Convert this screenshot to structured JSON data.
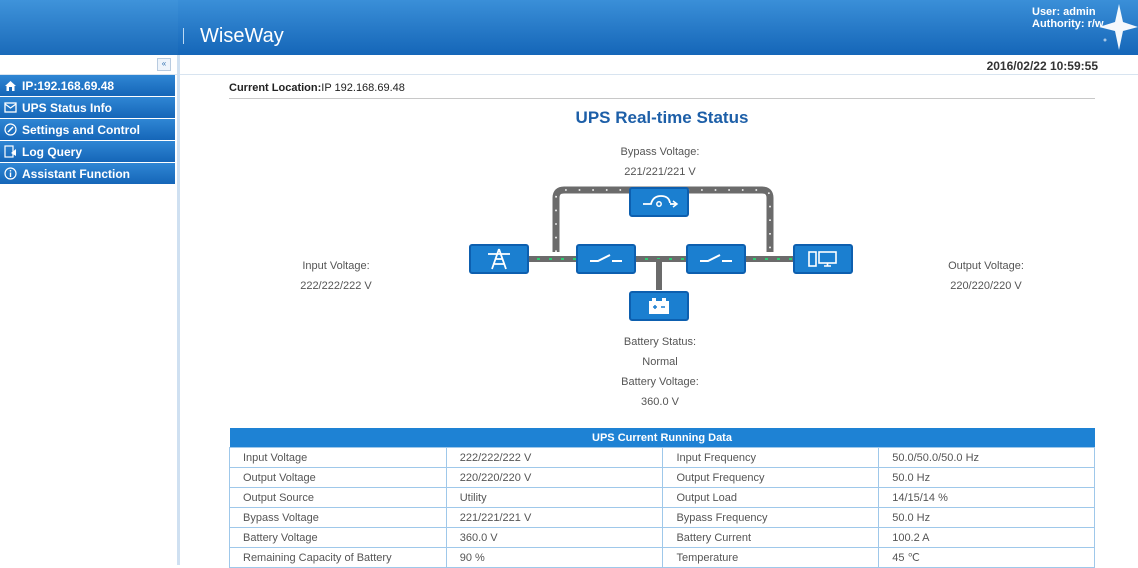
{
  "header": {
    "title": "WiseWay",
    "user": "User: admin",
    "authority": "Authority: r/w"
  },
  "datetime": "2016/02/22 10:59:55",
  "collapse_label": "«",
  "menu": [
    {
      "label": "IP:192.168.69.48",
      "icon": "home-icon"
    },
    {
      "label": "UPS Status Info",
      "icon": "status-info-icon"
    },
    {
      "label": "Settings and Control",
      "icon": "settings-icon"
    },
    {
      "label": "Log Query",
      "icon": "log-icon"
    },
    {
      "label": "Assistant Function",
      "icon": "info-icon"
    }
  ],
  "location": {
    "prefix": "Current Location:",
    "value": "IP 192.168.69.48"
  },
  "realtime": {
    "title": "UPS Real-time Status",
    "bypass_label": "Bypass Voltage:",
    "bypass_value": "221/221/221 V",
    "input_label": "Input Voltage:",
    "input_value": "222/222/222 V",
    "output_label": "Output Voltage:",
    "output_value": "220/220/220 V",
    "battery_status_label": "Battery Status:",
    "battery_status_value": "Normal",
    "battery_voltage_label": "Battery Voltage:",
    "battery_voltage_value": "360.0 V"
  },
  "running": {
    "title": "UPS Current Running Data",
    "rows": [
      [
        "Input Voltage",
        "222/222/222 V",
        "Input Frequency",
        "50.0/50.0/50.0 Hz"
      ],
      [
        "Output Voltage",
        "220/220/220 V",
        "Output Frequency",
        "50.0 Hz"
      ],
      [
        "Output Source",
        "Utility",
        "Output Load",
        "14/15/14 %"
      ],
      [
        "Bypass Voltage",
        "221/221/221 V",
        "Bypass Frequency",
        "50.0 Hz"
      ],
      [
        "Battery Voltage",
        "360.0 V",
        "Battery Current",
        "100.2 A"
      ],
      [
        "Remaining Capacity of Battery",
        "90 %",
        "Temperature",
        "45 ℃"
      ]
    ]
  },
  "colors": {
    "brand": "#1566b8",
    "tile": "#1b7fd0",
    "pipe": "#6b6b6b",
    "accent_green": "#2ecc71"
  }
}
